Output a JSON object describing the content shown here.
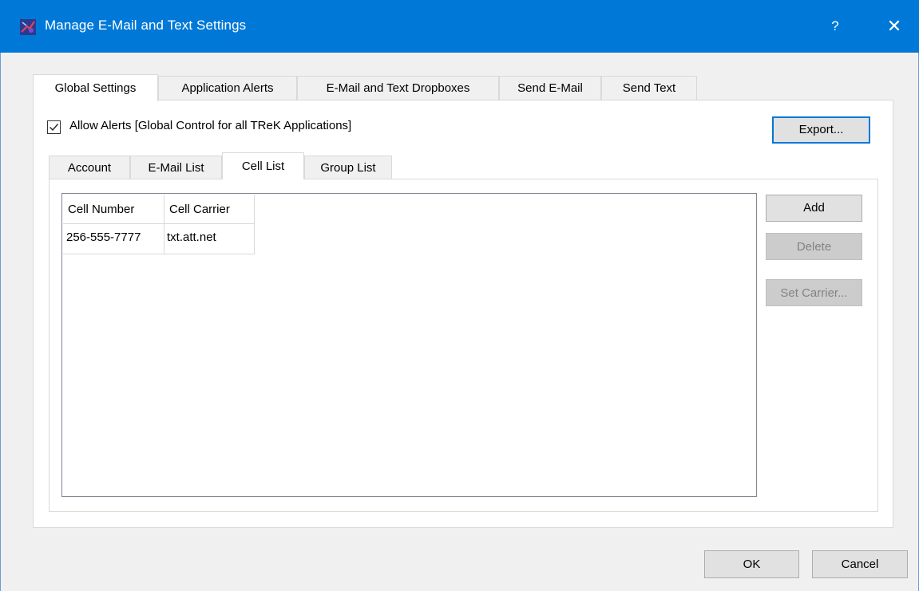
{
  "window": {
    "title": "Manage E-Mail and Text Settings",
    "help_glyph": "?",
    "close_glyph": "✕",
    "icon": "trek-app-icon"
  },
  "main_tabs": [
    {
      "label": "Global Settings",
      "active": true
    },
    {
      "label": "Application Alerts",
      "active": false
    },
    {
      "label": "E-Mail and Text Dropboxes",
      "active": false
    },
    {
      "label": "Send E-Mail",
      "active": false
    },
    {
      "label": "Send Text",
      "active": false
    }
  ],
  "global": {
    "allow_alerts_label": "Allow Alerts [Global Control for all TReK  Applications]",
    "allow_alerts_checked": true,
    "export_label": "Export..."
  },
  "sub_tabs": [
    {
      "label": "Account",
      "active": false
    },
    {
      "label": "E-Mail List",
      "active": false
    },
    {
      "label": "Cell List",
      "active": true
    },
    {
      "label": "Group List",
      "active": false
    }
  ],
  "cell_list": {
    "columns": [
      "Cell Number",
      "Cell Carrier"
    ],
    "rows": [
      [
        "256-555-7777",
        "txt.att.net"
      ]
    ]
  },
  "side_buttons": {
    "add": "Add",
    "delete": "Delete",
    "set_carrier": "Set Carrier..."
  },
  "dialog_buttons": {
    "ok": "OK",
    "cancel": "Cancel"
  },
  "colors": {
    "title_bar": "#0078d7",
    "default_button_border": "#0078d7"
  }
}
